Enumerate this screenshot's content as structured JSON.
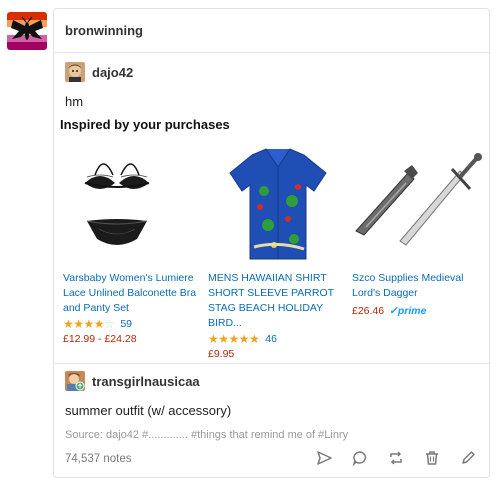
{
  "blog": {
    "name": "bronwinning"
  },
  "post": {
    "reblog_1": {
      "username": "dajo42",
      "body": "hm"
    },
    "section_heading": "Inspired by your purchases",
    "products": [
      {
        "title": "Varsbaby Women's Lumiere Lace Unlined Balconette Bra and Panty Set",
        "rating": "3.5",
        "rating_count": "59",
        "price": "£12.99 - £24.28"
      },
      {
        "title": "MENS HAWAIIAN SHIRT SHORT SLEEVE PARROT STAG BEACH HOLIDAY BIRD...",
        "rating": "4.5",
        "rating_count": "46",
        "price": "£9.95"
      },
      {
        "title": "Szco Supplies Medieval Lord's Dagger",
        "price": "£26.46",
        "prime": "✓prime"
      }
    ],
    "reblog_2": {
      "username": "transgirlnausicaa",
      "body": "summer outfit (w/ accessory)"
    },
    "source_line": "Source: dajo42 #.............  #things that remind me of  #Linry",
    "notes": "74,537 notes"
  },
  "colors": {
    "link": "#0a6cb4",
    "price": "#b12704",
    "star": "#f0a31f",
    "prime": "#1a98ff"
  },
  "icons": [
    "share-icon",
    "reply-icon",
    "reblog-icon",
    "delete-icon",
    "edit-icon"
  ]
}
